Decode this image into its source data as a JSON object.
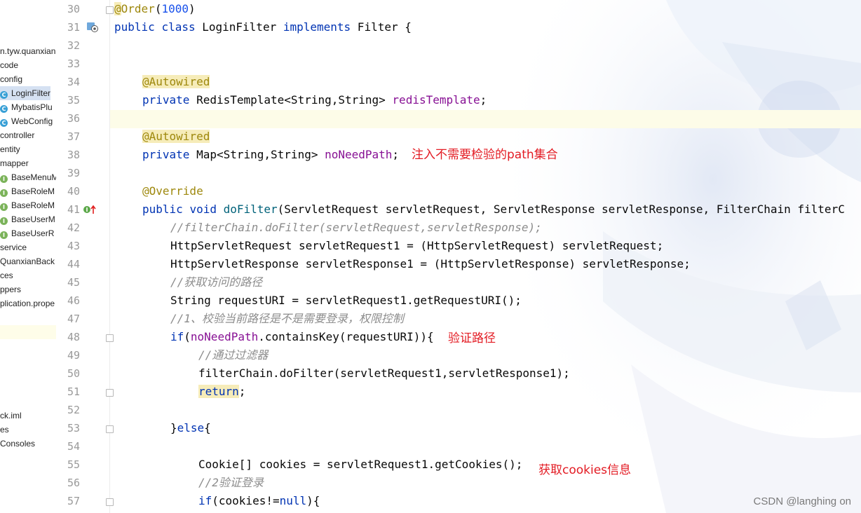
{
  "tree": {
    "items": [
      {
        "label": "n.tyw.quanxian",
        "icon": "none"
      },
      {
        "label": "code",
        "icon": "none"
      },
      {
        "label": "config",
        "icon": "none"
      },
      {
        "label": "LoginFilter",
        "icon": "class-icon",
        "selected": true
      },
      {
        "label": "MybatisPlu",
        "icon": "class-icon"
      },
      {
        "label": "WebConfig",
        "icon": "class-icon"
      },
      {
        "label": "controller",
        "icon": "none"
      },
      {
        "label": "entity",
        "icon": "none"
      },
      {
        "label": "mapper",
        "icon": "none"
      },
      {
        "label": "BaseMenuM",
        "icon": "interface-icon"
      },
      {
        "label": "BaseRoleM",
        "icon": "interface-icon"
      },
      {
        "label": "BaseRoleM",
        "icon": "interface-icon"
      },
      {
        "label": "BaseUserM",
        "icon": "interface-icon"
      },
      {
        "label": "BaseUserR",
        "icon": "interface-icon"
      },
      {
        "label": "service",
        "icon": "none"
      },
      {
        "label": "QuanxianBack",
        "icon": "none"
      },
      {
        "label": "ces",
        "icon": "none"
      },
      {
        "label": "ppers",
        "icon": "none"
      },
      {
        "label": "plication.prope",
        "icon": "none"
      }
    ],
    "bottom_items": [
      {
        "label": "ck.iml"
      },
      {
        "label": "es"
      },
      {
        "label": "Consoles"
      }
    ]
  },
  "editor": {
    "line_numbers": [
      "30",
      "31",
      "32",
      "33",
      "34",
      "35",
      "36",
      "37",
      "38",
      "39",
      "40",
      "41",
      "42",
      "43",
      "44",
      "45",
      "46",
      "47",
      "48",
      "49",
      "50",
      "51",
      "52",
      "53",
      "54",
      "55",
      "56",
      "57"
    ],
    "code": {
      "l30": {
        "at": "@",
        "order": "Order",
        "open": "(",
        "num": "1000",
        "close": ")"
      },
      "l31": {
        "kw1": "public",
        "kw2": "class",
        "name": " LoginFilter ",
        "kw3": "implements",
        "rest": " Filter {"
      },
      "l34": {
        "ann": "@Autowired"
      },
      "l35": {
        "kw": "private",
        "type": " RedisTemplate<String,String> ",
        "field": "redisTemplate",
        "end": ";"
      },
      "l37": {
        "ann": "@Autowired"
      },
      "l38": {
        "kw": "private",
        "type": " Map<String,String> ",
        "field": "noNeedPath",
        "end": ";"
      },
      "l40": {
        "ann": "@Override"
      },
      "l41": {
        "kw1": "public",
        "kw2": "void",
        "method": "doFilter",
        "rest": "(ServletRequest servletRequest, ServletResponse servletResponse, FilterChain filterC"
      },
      "l42": {
        "comment": "//filterChain.doFilter(servletRequest,servletResponse);"
      },
      "l43": {
        "text": "HttpServletRequest servletRequest1 = (HttpServletRequest) servletRequest;"
      },
      "l44": {
        "text": "HttpServletResponse servletResponse1 = (HttpServletResponse) servletResponse;"
      },
      "l45": {
        "comment": "//获取访问的路径"
      },
      "l46": {
        "text": "String requestURI = servletRequest1.getRequestURI();"
      },
      "l47": {
        "comment": "//1、校验当前路径是不是需要登录，权限控制"
      },
      "l48": {
        "kw": "if",
        "open": "(",
        "field": "noNeedPath",
        "rest": ".containsKey(requestURI)){"
      },
      "l49": {
        "comment": "//通过过滤器"
      },
      "l50": {
        "text": "filterChain.doFilter(servletRequest1,servletResponse1);"
      },
      "l51": {
        "kw": "return",
        "end": ";"
      },
      "l53": {
        "open": "}",
        "kw": "else",
        "rest": "{"
      },
      "l55": {
        "text": "Cookie[] cookies = servletRequest1.getCookies();"
      },
      "l56": {
        "comment": "//2验证登录"
      },
      "l57": {
        "kw": "if",
        "mid": "(cookies!=",
        "kw2": "null",
        "end": "){"
      }
    }
  },
  "annotations": {
    "inject_note": "注入不需要检验的path集合",
    "verify_path_note": "验证路径",
    "get_cookies_note": "获取cookies信息"
  },
  "watermark": "CSDN @langhing on",
  "colors": {
    "keyword": "#0033b3",
    "annotation": "#9e880d",
    "field": "#871094",
    "comment": "#8c8c8c",
    "method": "#00627a",
    "number": "#1750eb",
    "note_red": "#e31b23"
  }
}
